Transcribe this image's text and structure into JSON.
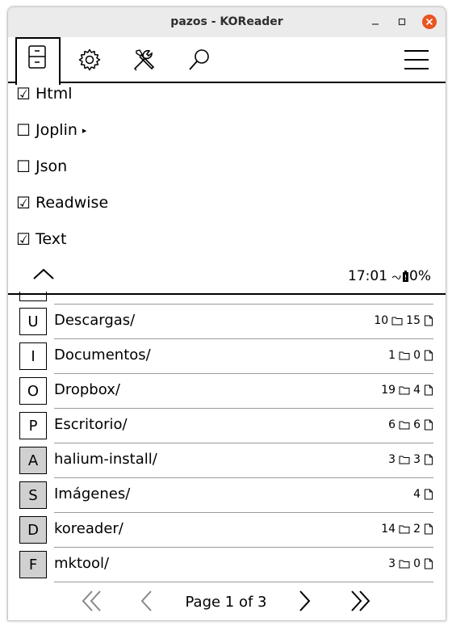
{
  "window": {
    "title": "pazos - KOReader",
    "minimize_icon": "minimize-icon",
    "maximize_icon": "maximize-icon",
    "close_icon": "close-icon",
    "close_color": "#e95420"
  },
  "menubar": {
    "tabs": [
      "filemanager-icon",
      "settings-gear-icon",
      "tools-icon",
      "search-icon"
    ],
    "hamburger": "hamburger-menu-icon"
  },
  "menu": {
    "items": [
      {
        "check": "☑",
        "checked": true,
        "label": "Html"
      },
      {
        "check": "☐",
        "checked": false,
        "label": "Joplin",
        "submenu": "▸"
      },
      {
        "check": "☐",
        "checked": false,
        "label": "Json"
      },
      {
        "check": "☑",
        "checked": true,
        "label": "Readwise"
      },
      {
        "check": "☑",
        "checked": true,
        "label": "Text"
      }
    ],
    "collapse_icon": "chevron-up-icon",
    "status": {
      "time": "17:01",
      "battery": "0%"
    }
  },
  "files": [
    {
      "key": "U",
      "name": "Descargas/",
      "folders": "10",
      "files": "15",
      "shaded": false
    },
    {
      "key": "I",
      "name": "Documentos/",
      "folders": "1",
      "files": "0",
      "shaded": false
    },
    {
      "key": "O",
      "name": "Dropbox/",
      "folders": "19",
      "files": "4",
      "shaded": false
    },
    {
      "key": "P",
      "name": "Escritorio/",
      "folders": "6",
      "files": "6",
      "shaded": false
    },
    {
      "key": "A",
      "name": "halium-install/",
      "folders": "3",
      "files": "3",
      "shaded": true
    },
    {
      "key": "S",
      "name": "Imágenes/",
      "folders": "",
      "files": "4",
      "shaded": true
    },
    {
      "key": "D",
      "name": "koreader/",
      "folders": "14",
      "files": "2",
      "shaded": true
    },
    {
      "key": "F",
      "name": "mktool/",
      "folders": "3",
      "files": "0",
      "shaded": true
    }
  ],
  "pager": {
    "text": "Page 1 of 3"
  }
}
